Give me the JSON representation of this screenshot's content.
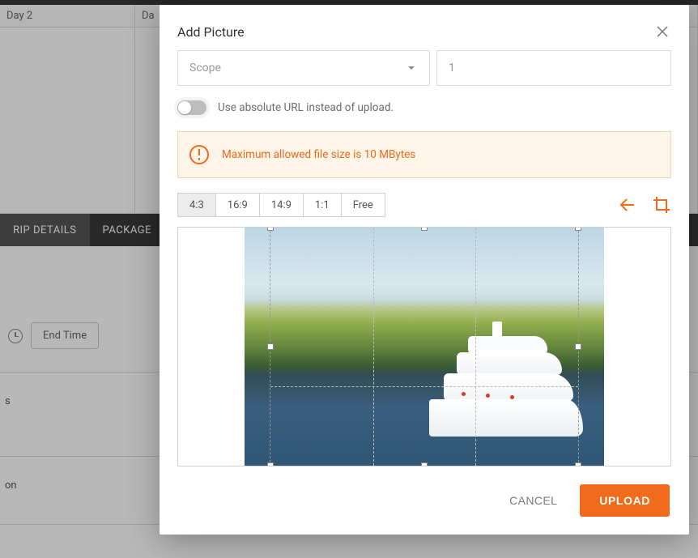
{
  "bg": {
    "cols": [
      "Day 2",
      "Da"
    ],
    "tabs": {
      "left": "RIP DETAILS",
      "right": "PACKAGE"
    },
    "endtime_label": "End Time",
    "stub_s": "s",
    "stub_on": "on"
  },
  "modal": {
    "title": "Add Picture",
    "scope_placeholder": "Scope",
    "number_value": "1",
    "toggle_label": "Use absolute URL instead of upload.",
    "alert": "Maximum allowed file size is 10 MBytes",
    "ratios": [
      "4:3",
      "16:9",
      "14:9",
      "1:1",
      "Free"
    ],
    "active_ratio": 0,
    "cancel": "CANCEL",
    "upload": "UPLOAD"
  }
}
